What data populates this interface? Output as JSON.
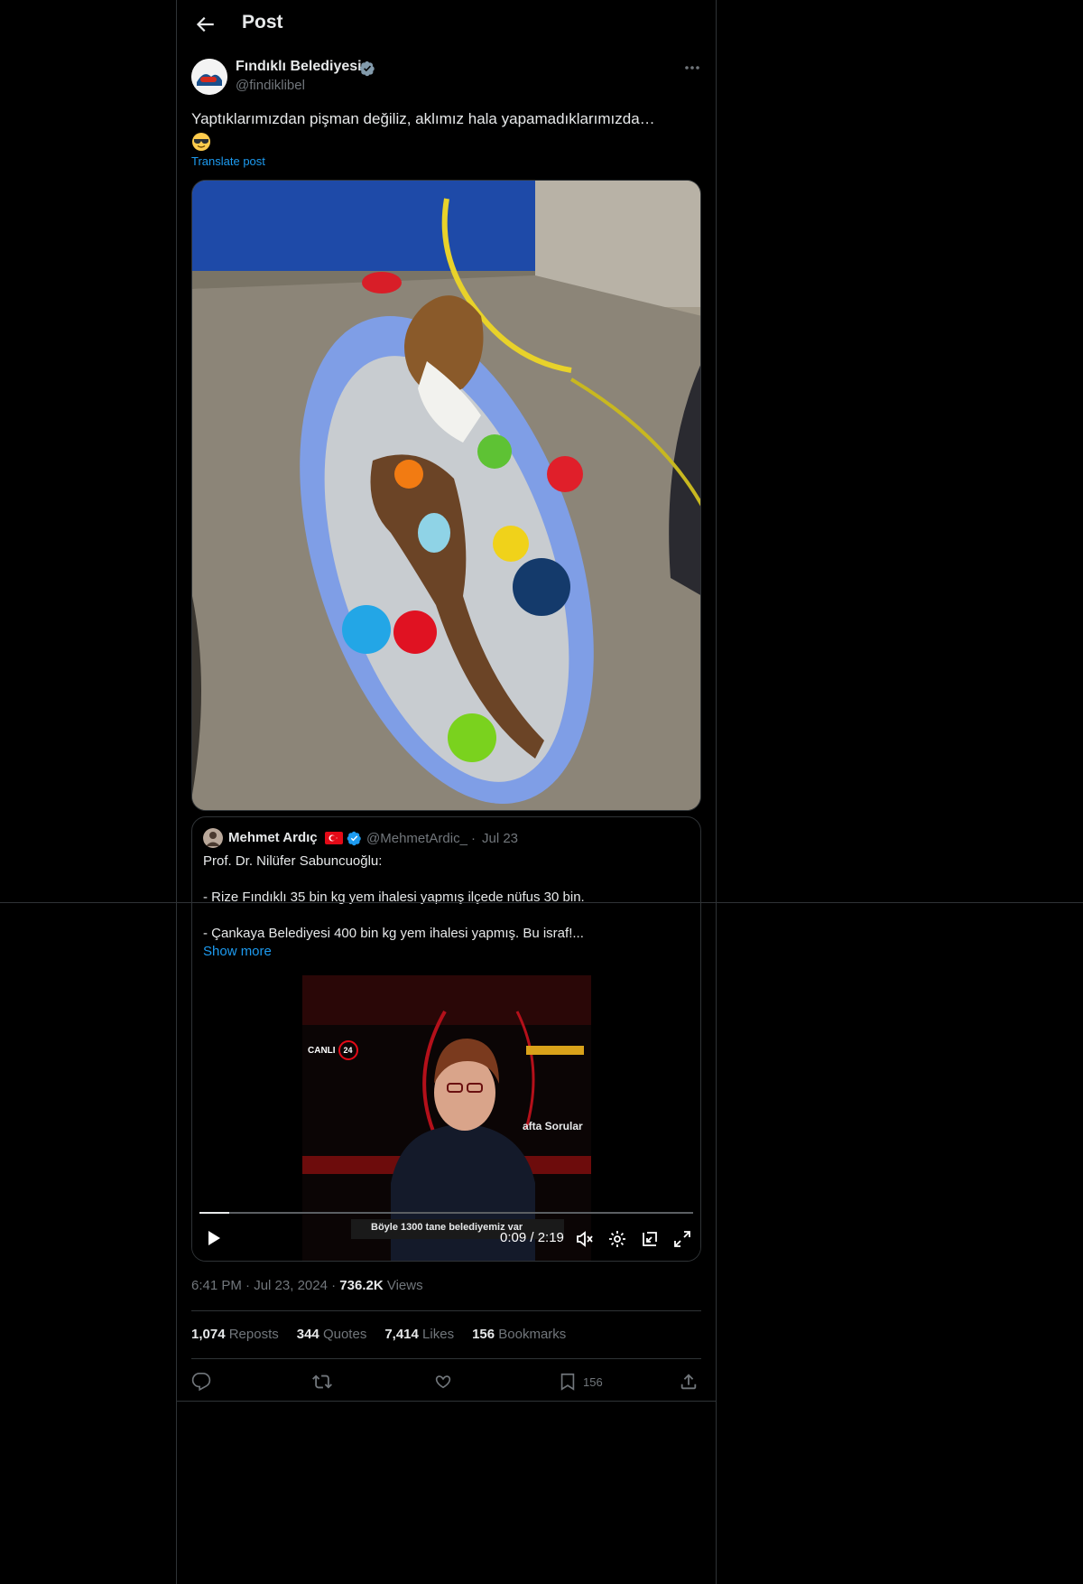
{
  "header": {
    "title": "Post"
  },
  "author": {
    "name": "Fındıklı Belediyesi",
    "handle": "@findiklibel"
  },
  "post": {
    "text": "Yaptıklarımızdan pişman değiliz, aklımız hala yapamadıklarımızda…",
    "emoji": "smiling-face-with-sunglasses",
    "translate_label": "Translate post"
  },
  "quote": {
    "name": "Mehmet Ardıç",
    "handle": "@MehmetArdic_",
    "dot": "·",
    "date": "Jul 23",
    "lines": [
      "Prof. Dr. Nilüfer Sabuncuoğlu:",
      "- Rize Fındıklı 35 bin kg yem ihalesi yapmış ilçede nüfus 30 bin.",
      "- Çankaya Belediyesi 400 bin kg yem ihalesi yapmış. Bu israf!..."
    ],
    "show_more": "Show more",
    "video": {
      "time": "0:09 / 2:19",
      "progress": 0.06,
      "overlay_logo": "CANLI",
      "overlay_logo_num": "24",
      "overlay_side": "afta Sorular",
      "overlay_caption": "Böyle 1300 tane belediyemiz var"
    }
  },
  "meta": {
    "time": "6:41 PM",
    "dot": "·",
    "date": "Jul 23, 2024",
    "views_count": "736.2K",
    "views_label": "Views"
  },
  "stats": [
    {
      "count": "1,074",
      "label": "Reposts"
    },
    {
      "count": "344",
      "label": "Quotes"
    },
    {
      "count": "7,414",
      "label": "Likes"
    },
    {
      "count": "156",
      "label": "Bookmarks"
    }
  ],
  "actions": {
    "bookmark_count": "156"
  },
  "colors": {
    "accent": "#1d9bf0",
    "muted": "#71767b",
    "text": "#e7e9ea",
    "border": "#2f3336"
  }
}
